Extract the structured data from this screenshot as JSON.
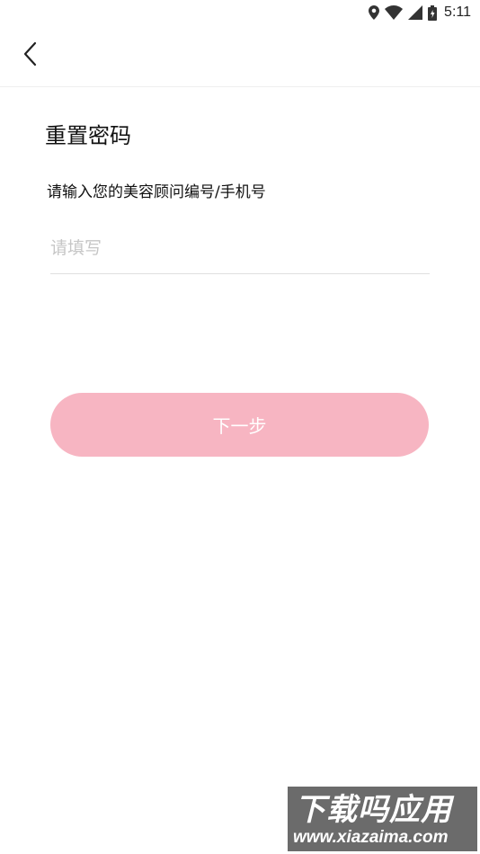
{
  "status_bar": {
    "time": "5:11",
    "icons": [
      "location-icon",
      "wifi-icon",
      "signal-icon",
      "battery-icon"
    ]
  },
  "app_bar": {
    "back_icon": "back-arrow-icon"
  },
  "main": {
    "title": "重置密码",
    "field_label": "请输入您的美容顾问编号/手机号",
    "input": {
      "value": "",
      "placeholder": "请填写"
    },
    "next_button_label": "下一步"
  },
  "watermark": {
    "line1": "下载吗应用",
    "line2": "www.xiazaima.com"
  },
  "colors": {
    "button_bg": "#f7b5c2",
    "placeholder": "#c6c6c6",
    "divider": "#e0e0e0"
  }
}
